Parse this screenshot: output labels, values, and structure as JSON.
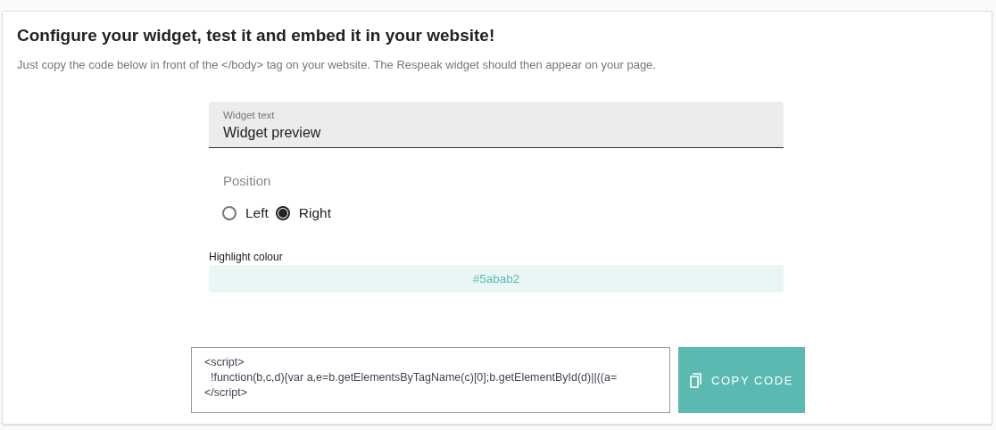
{
  "title": "Configure your widget, test it and embed it in your website!",
  "subtitle": "Just copy the code below in front of the </body> tag on your website. The Respeak widget should then appear on your page.",
  "widget_text": {
    "label": "Widget text",
    "value": "Widget preview"
  },
  "position": {
    "label": "Position",
    "options": [
      {
        "label": "Left",
        "selected": false
      },
      {
        "label": "Right",
        "selected": true
      }
    ]
  },
  "highlight_colour": {
    "label": "Highlight colour",
    "value": "#5abab2"
  },
  "code": [
    "<script>",
    "  !function(b,c,d){var a,e=b.getElementsByTagName(c)[0];b.getElementById(d)||((a=",
    "</script>"
  ],
  "copy_button": {
    "label": "COPY CODE"
  }
}
